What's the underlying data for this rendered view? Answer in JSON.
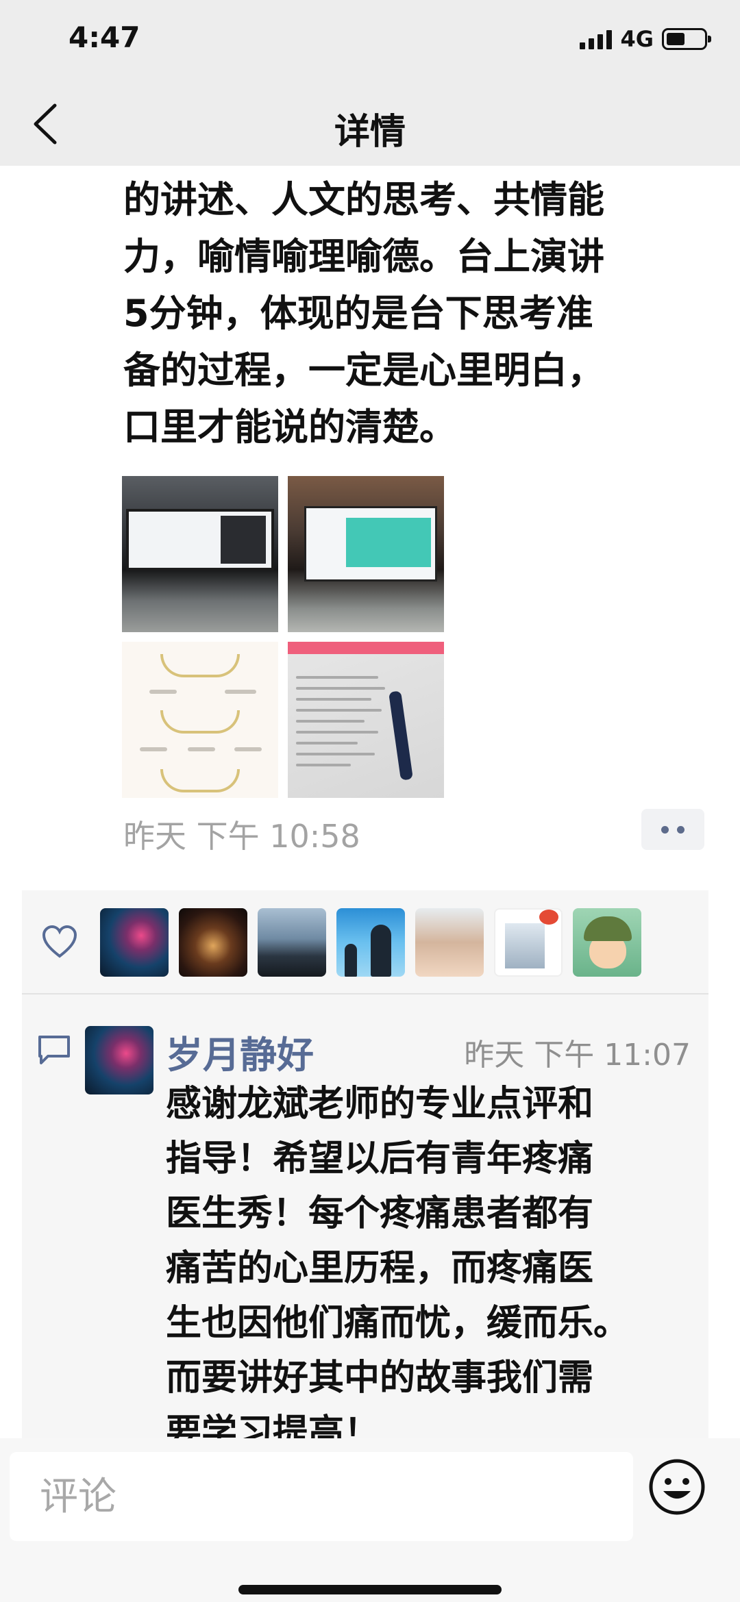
{
  "status_bar": {
    "time": "4:47",
    "network": "4G",
    "battery_level": 0.5
  },
  "nav": {
    "back_icon": "chevron-left-icon",
    "title": "详情"
  },
  "post": {
    "text": "的讲述、人文的思考、共情能\n力，喻情喻理喻德。台上演讲\n5分钟，体现的是台下思考准\n备的过程，一定是心里明白，\n口里才能说的清楚。",
    "photos": [
      "lecture-screen-photo",
      "presentation-screen-photo",
      "award-certificate-photo",
      "paper-with-pen-photo"
    ],
    "time": "昨天 下午 10:58",
    "more_icon": "more-dots-icon"
  },
  "likes": {
    "icon": "heart-outline-icon",
    "avatar_count": 7
  },
  "comments": [
    {
      "icon": "comment-bubble-icon",
      "name": "岁月静好",
      "time": "昨天 下午 11:07",
      "text": "感谢龙斌老师的专业点评和\n指导！希望以后有青年疼痛\n医生秀！每个疼痛患者都有\n痛苦的心里历程，而疼痛医\n生也因他们痛而忧，缓而乐。\n而要讲好其中的故事我们需\n要学习提高！"
    }
  ],
  "input": {
    "placeholder": "评论",
    "emoji_icon": "emoji-smile-icon"
  },
  "colors": {
    "bar_background": "#ededed",
    "link_blue": "#576b95",
    "secondary_text": "#a3a3a3"
  }
}
